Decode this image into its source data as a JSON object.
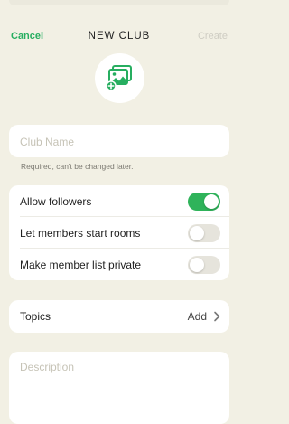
{
  "header": {
    "cancel_label": "Cancel",
    "title": "NEW CLUB",
    "create_label": "Create"
  },
  "avatar": {
    "icon": "add-image-icon",
    "accent": "#27ae60"
  },
  "club_name": {
    "placeholder": "Club Name",
    "value": "",
    "hint": "Required, can't be changed later."
  },
  "settings": [
    {
      "label": "Allow followers",
      "enabled": true
    },
    {
      "label": "Let members start rooms",
      "enabled": false
    },
    {
      "label": "Make member list private",
      "enabled": false
    }
  ],
  "topics": {
    "label": "Topics",
    "action": "Add",
    "icon": "chevron-right-icon"
  },
  "description": {
    "placeholder": "Description",
    "value": ""
  },
  "colors": {
    "background": "#f2f0e4",
    "accent": "#27ae60",
    "toggle_on": "#2fb35a",
    "disabled_text": "#cfcdc3"
  }
}
